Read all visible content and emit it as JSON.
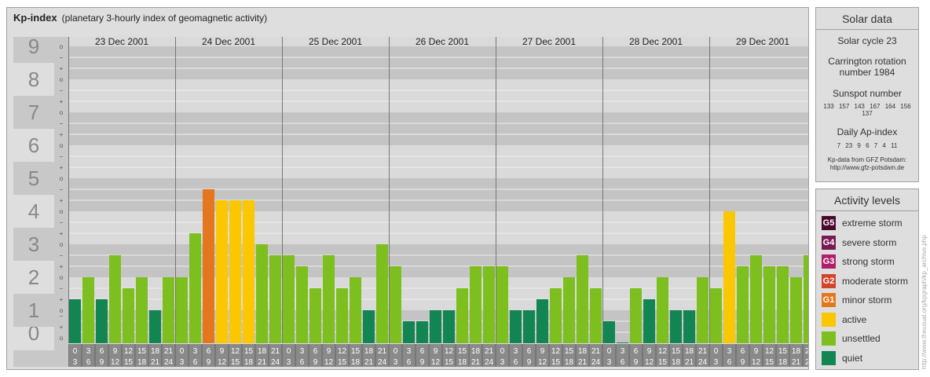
{
  "header": {
    "title": "Kp-index",
    "subtitle": "(planetary 3-hourly index of geomagnetic activity)"
  },
  "chart_data": {
    "type": "bar",
    "title": "Kp-index",
    "subtitle": "(planetary 3-hourly index of geomagnetic activity)",
    "ylim": [
      0,
      9
    ],
    "y_ticks": [
      "0",
      "1",
      "2",
      "3",
      "4",
      "5",
      "6",
      "7",
      "8",
      "9"
    ],
    "minor_ticks": [
      "o",
      "+",
      "−"
    ],
    "days": [
      "23 Dec 2001",
      "24 Dec 2001",
      "25 Dec 2001",
      "26 Dec 2001",
      "27 Dec 2001",
      "28 Dec 2001",
      "29 Dec 2001"
    ],
    "interval_start": [
      "0",
      "3",
      "6",
      "9",
      "12",
      "15",
      "18",
      "21"
    ],
    "interval_end": [
      "3",
      "6",
      "9",
      "12",
      "15",
      "18",
      "21",
      "24"
    ],
    "values": [
      [
        1.333,
        2,
        1.333,
        2.667,
        1.667,
        2,
        1,
        2
      ],
      [
        2,
        3.333,
        4.667,
        4.333,
        4.333,
        4.333,
        3,
        2.667
      ],
      [
        2.667,
        2.333,
        1.667,
        2.667,
        1.667,
        2,
        1,
        3
      ],
      [
        2.333,
        0.667,
        0.667,
        1,
        1,
        1.667,
        2.333,
        2.333
      ],
      [
        2.333,
        1,
        1,
        1.333,
        1.667,
        2,
        2.667,
        1.667
      ],
      [
        0.667,
        0,
        1.667,
        1.333,
        2,
        1,
        1,
        2
      ],
      [
        1.667,
        4,
        2.333,
        2.667,
        2.333,
        2.333,
        2,
        2.667
      ]
    ],
    "colors": {
      "quiet": "#138553",
      "unsettled": "#7cbf1f",
      "active": "#fbc700",
      "minor": "#e4771e",
      "moderate": "#d1452b",
      "strong": "#b01e69",
      "severe": "#7a1a55",
      "extreme": "#4a0a2e"
    },
    "grid": true
  },
  "solar": {
    "title": "Solar data",
    "cycle": "Solar cycle 23",
    "carrington": "Carrington rotation number 1984",
    "sunspot_label": "Sunspot number",
    "sunspots": [
      "133",
      "157",
      "143",
      "167",
      "164",
      "156",
      "137"
    ],
    "ap_label": "Daily Ap-index",
    "ap": [
      "7",
      "23",
      "9",
      "6",
      "7",
      "4",
      "11"
    ],
    "credit1": "Kp-data from GFZ Potsdam:",
    "credit2": "http://www.gfz-potsdam.de"
  },
  "levels": {
    "title": "Activity levels",
    "items": [
      {
        "code": "G5",
        "label": "extreme storm",
        "color": "#4a0a2e"
      },
      {
        "code": "G4",
        "label": "severe storm",
        "color": "#7a1a55"
      },
      {
        "code": "G3",
        "label": "strong storm",
        "color": "#b01e69"
      },
      {
        "code": "G2",
        "label": "moderate storm",
        "color": "#d1452b"
      },
      {
        "code": "G1",
        "label": "minor storm",
        "color": "#e4771e"
      },
      {
        "code": "",
        "label": "active",
        "color": "#fbc700"
      },
      {
        "code": "",
        "label": "unsettled",
        "color": "#7cbf1f"
      },
      {
        "code": "",
        "label": "quiet",
        "color": "#138553"
      }
    ]
  },
  "watermark": "http://www.theusual.org/kpgraph/kp_archive.php"
}
